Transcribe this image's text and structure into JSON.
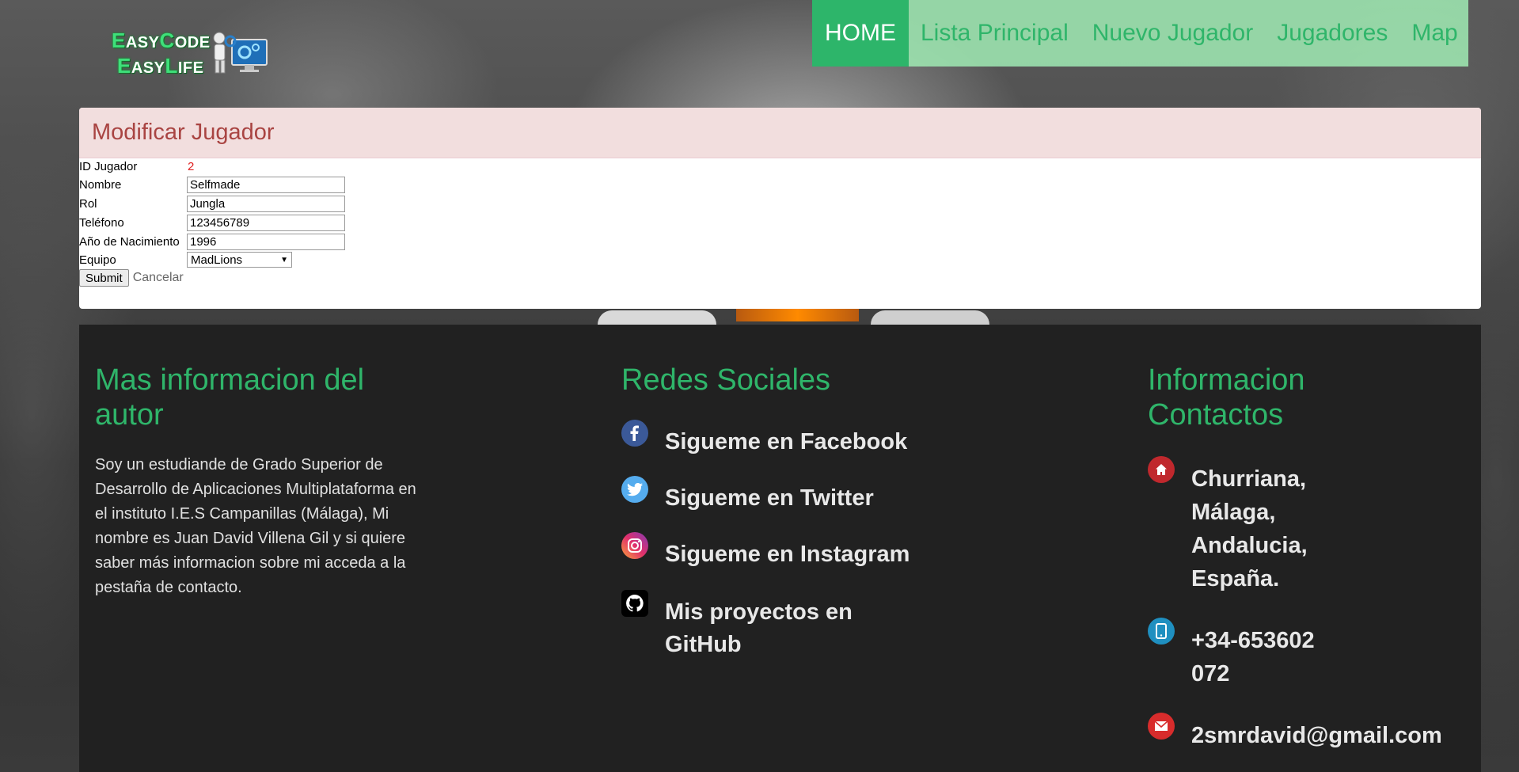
{
  "logo": {
    "line1": [
      "E",
      "ASY",
      "C",
      "ODE"
    ],
    "line2": [
      "E",
      "ASY",
      "L",
      "IFE"
    ]
  },
  "nav": {
    "items": [
      {
        "label": "HOME",
        "active": true
      },
      {
        "label": "Lista Principal",
        "active": false
      },
      {
        "label": "Nuevo Jugador",
        "active": false
      },
      {
        "label": "Jugadores",
        "active": false
      },
      {
        "label": "Map",
        "active": false
      }
    ]
  },
  "panel": {
    "title": "Modificar Jugador",
    "fields": {
      "id_label": "ID Jugador",
      "id_value": "2",
      "nombre_label": "Nombre",
      "nombre_value": "Selfmade",
      "rol_label": "Rol",
      "rol_value": "Jungla",
      "telefono_label": "Teléfono",
      "telefono_value": "123456789",
      "anio_label": "Año de Nacimiento",
      "anio_value": "1996",
      "equipo_label": "Equipo",
      "equipo_value": "MadLions"
    },
    "submit_label": "Submit",
    "cancel_label": "Cancelar"
  },
  "footer": {
    "about": {
      "title": "Mas informacion del autor",
      "text": "Soy un estudiande de Grado Superior de Desarrollo de Aplicaciones Multiplataforma en el instituto I.E.S Campanillas (Málaga), Mi nombre es Juan David Villena Gil y si quiere saber más informacion sobre mi acceda a la pestaña de contacto."
    },
    "social": {
      "title": "Redes Sociales",
      "items": [
        {
          "label": "Sigueme en Facebook",
          "icon": "facebook-icon"
        },
        {
          "label": "Sigueme en Twitter",
          "icon": "twitter-icon"
        },
        {
          "label": "Sigueme en Instagram",
          "icon": "instagram-icon"
        },
        {
          "label": "Mis proyectos en GitHub",
          "icon": "github-icon"
        }
      ]
    },
    "contact": {
      "title": "Informacion Contactos",
      "address": "Churriana, Málaga, Andalucia, España.",
      "phone": "+34-653602072",
      "email": "2smrdavid@gmail.com"
    }
  },
  "colors": {
    "accent": "#2db56a",
    "nav_bg": "#a0ebb4",
    "panel_head_bg": "#f2dede",
    "panel_title": "#a94442",
    "footer_bg": "#212121"
  }
}
